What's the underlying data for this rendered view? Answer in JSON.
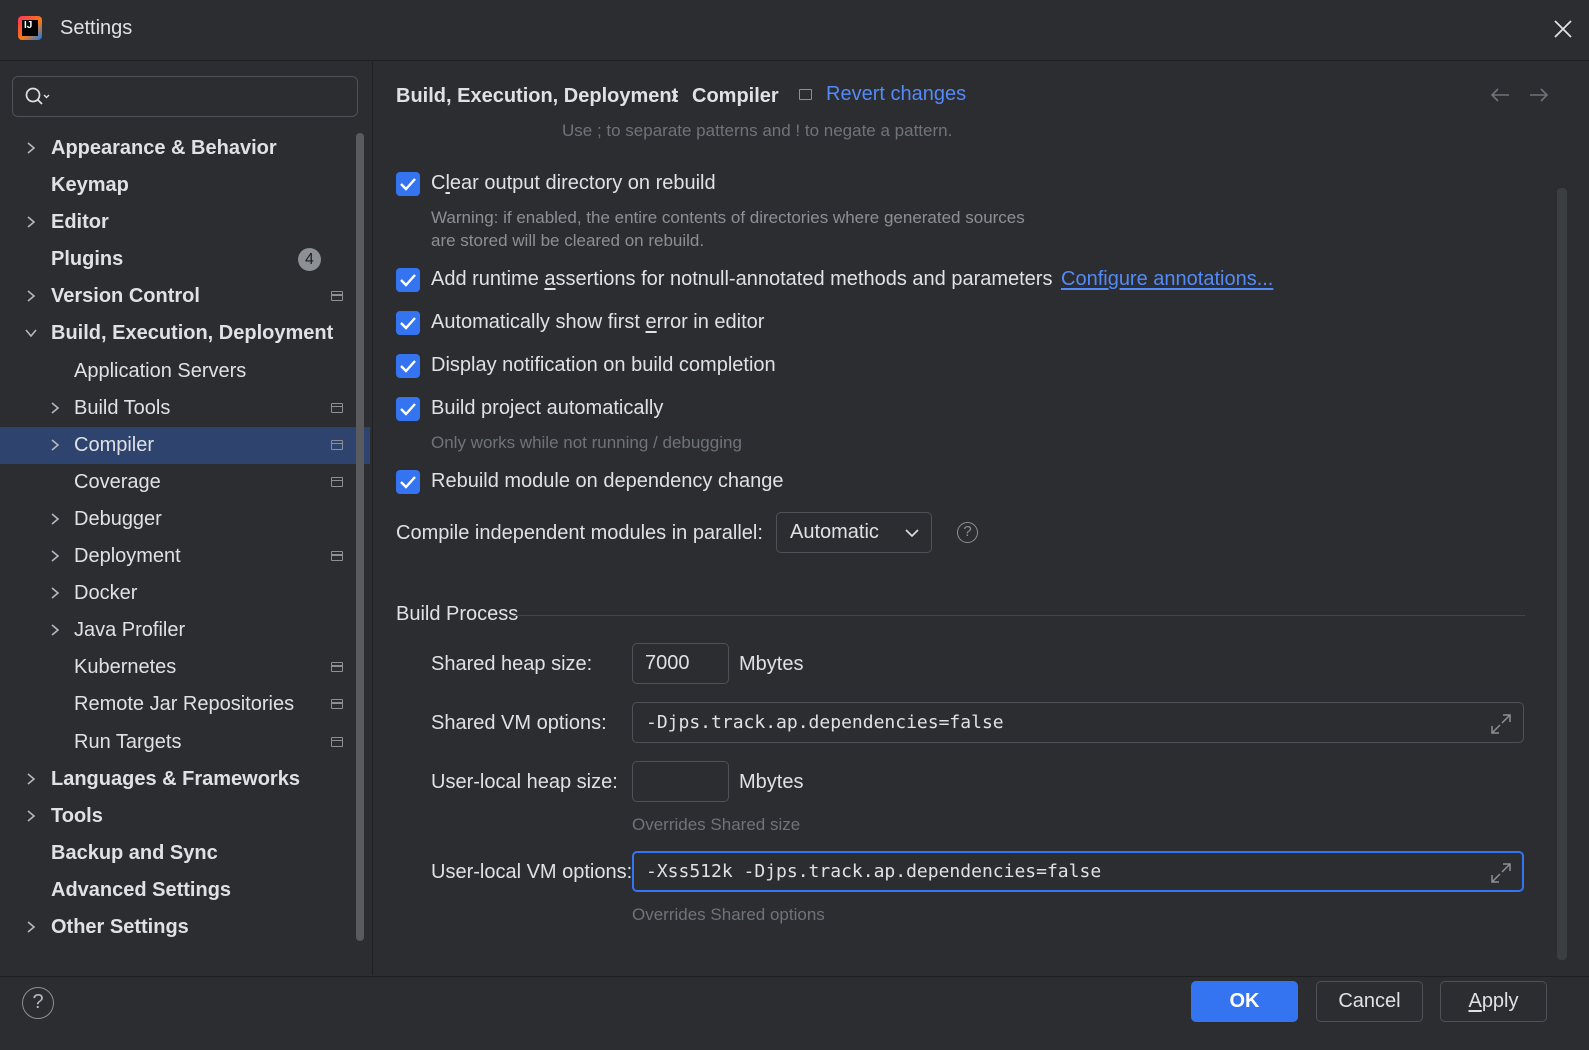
{
  "window": {
    "title": "Settings",
    "close_icon": "close-icon",
    "logo_text": "IJ"
  },
  "search": {
    "value": "",
    "placeholder": ""
  },
  "tree": [
    {
      "label": "Appearance & Behavior",
      "level": 0,
      "chevron": "right",
      "project_icon": false
    },
    {
      "label": "Keymap",
      "level": 0,
      "chevron": null,
      "project_icon": false
    },
    {
      "label": "Editor",
      "level": 0,
      "chevron": "right",
      "project_icon": false
    },
    {
      "label": "Plugins",
      "level": 0,
      "chevron": null,
      "project_icon": false,
      "badge": "4"
    },
    {
      "label": "Version Control",
      "level": 0,
      "chevron": "right",
      "project_icon": true
    },
    {
      "label": "Build, Execution, Deployment",
      "level": 0,
      "chevron": "down",
      "project_icon": false
    },
    {
      "label": "Application Servers",
      "level": 1,
      "chevron": null,
      "project_icon": false
    },
    {
      "label": "Build Tools",
      "level": 1,
      "chevron": "right",
      "project_icon": true
    },
    {
      "label": "Compiler",
      "level": 1,
      "chevron": "right",
      "project_icon": true,
      "selected": true
    },
    {
      "label": "Coverage",
      "level": 1,
      "chevron": null,
      "project_icon": true
    },
    {
      "label": "Debugger",
      "level": 1,
      "chevron": "right",
      "project_icon": false
    },
    {
      "label": "Deployment",
      "level": 1,
      "chevron": "right",
      "project_icon": true
    },
    {
      "label": "Docker",
      "level": 1,
      "chevron": "right",
      "project_icon": false
    },
    {
      "label": "Java Profiler",
      "level": 1,
      "chevron": "right",
      "project_icon": false
    },
    {
      "label": "Kubernetes",
      "level": 1,
      "chevron": null,
      "project_icon": true
    },
    {
      "label": "Remote Jar Repositories",
      "level": 1,
      "chevron": null,
      "project_icon": true
    },
    {
      "label": "Run Targets",
      "level": 1,
      "chevron": null,
      "project_icon": true
    },
    {
      "label": "Languages & Frameworks",
      "level": 0,
      "chevron": "right",
      "project_icon": false
    },
    {
      "label": "Tools",
      "level": 0,
      "chevron": "right",
      "project_icon": false
    },
    {
      "label": "Backup and Sync",
      "level": 0,
      "chevron": null,
      "project_icon": false
    },
    {
      "label": "Advanced Settings",
      "level": 0,
      "chevron": null,
      "project_icon": false
    },
    {
      "label": "Other Settings",
      "level": 0,
      "chevron": "right",
      "project_icon": false
    }
  ],
  "breadcrumb": {
    "parent": "Build, Execution, Deployment",
    "separator": "›",
    "current": "Compiler"
  },
  "revert_changes": "Revert changes",
  "hint_top": "Use ; to separate patterns and ! to negate a pattern.",
  "options": {
    "clear_output": {
      "pre": "C",
      "u": "l",
      "post": "ear output directory on rebuild",
      "checked": true
    },
    "clear_output_note_1": "Warning: if enabled, the entire contents of directories where generated sources",
    "clear_output_note_2": "are stored will be cleared on rebuild.",
    "runtime_assertions": {
      "pre": "Add runtime ",
      "u": "a",
      "post": "ssertions for notnull-annotated methods and parameters",
      "checked": true
    },
    "configure_annotations": "Configure annotations...",
    "show_first_error": {
      "pre": "Automatically show first ",
      "u": "e",
      "post": "rror in editor",
      "checked": true
    },
    "display_notification": {
      "label": "Display notification on build completion",
      "checked": true
    },
    "build_automatically": {
      "label": "Build project automatically",
      "checked": true
    },
    "build_automatically_note": "Only works while not running / debugging",
    "rebuild_module": {
      "label": "Rebuild module on dependency change",
      "checked": true
    }
  },
  "parallel": {
    "label": "Compile independent modules in parallel:",
    "value": "Automatic"
  },
  "build_process": {
    "title": "Build Process",
    "shared_heap_label": "Shared heap size:",
    "shared_heap_value": "7000",
    "unit": "Mbytes",
    "shared_vm_label": "Shared VM options:",
    "shared_vm_value": "-Djps.track.ap.dependencies=false",
    "local_heap_label": "User-local heap size:",
    "local_heap_value": "",
    "local_heap_note": "Overrides Shared size",
    "local_vm_label": "User-local VM options:",
    "local_vm_value": "-Xss512k -Djps.track.ap.dependencies=false",
    "local_vm_note": "Overrides Shared options"
  },
  "footer": {
    "help": "?",
    "ok": "OK",
    "cancel": "Cancel",
    "apply_u": "A",
    "apply_rest": "pply"
  },
  "colors": {
    "accent": "#3574f0",
    "link": "#548af7",
    "background": "#2b2d30",
    "selection": "#2e436e"
  }
}
